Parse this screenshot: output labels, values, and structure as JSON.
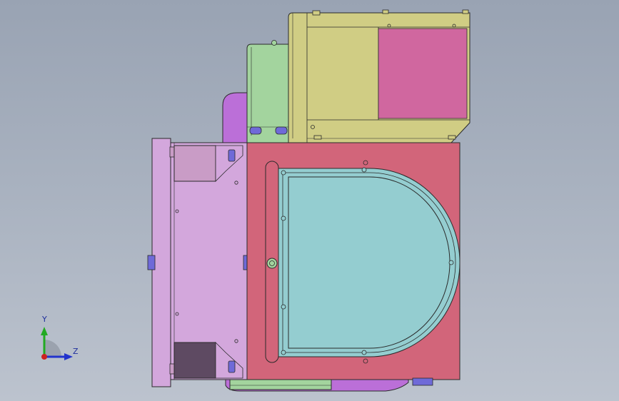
{
  "colors": {
    "background_top": "#99a3b3",
    "background_bottom": "#bcc3ce",
    "outline": "#2a2a2a",
    "red_housing": "#d2657a",
    "cyan_door": "#94cdd0",
    "pink_side_plate": "#d3a7dc",
    "pink_block": "#c99cc6",
    "dark_block": "#5e4a62",
    "olive_motor": "#d0cd84",
    "magenta_cover": "#d0679f",
    "green_bracket": "#a3d49e",
    "violet_part": "#bb6fd8",
    "blue_pad": "#6f6ad8",
    "triad_y": "#22aa22",
    "triad_z": "#2233cc",
    "triad_origin": "#cc2222"
  },
  "triad": {
    "y_label": "Y",
    "z_label": "Z"
  }
}
